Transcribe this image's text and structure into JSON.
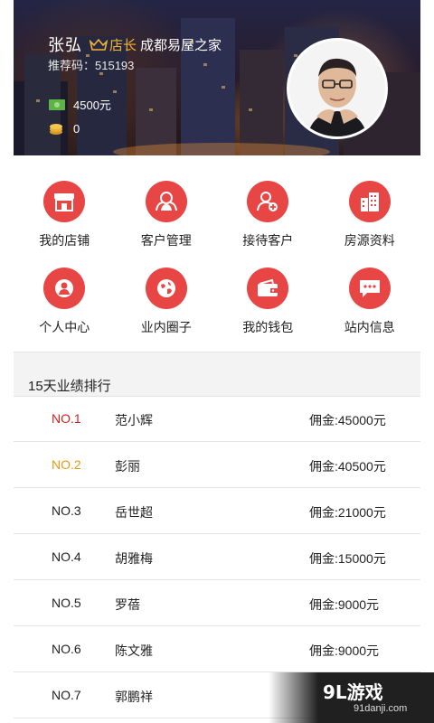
{
  "header": {
    "name": "张弘",
    "role": "店长",
    "store": "成都易屋之家",
    "referral_code": "推荐码：515193",
    "balance": "4500元",
    "coins": "0"
  },
  "menu": [
    {
      "label": "我的店铺",
      "icon": "shop-icon"
    },
    {
      "label": "客户管理",
      "icon": "users-icon"
    },
    {
      "label": "接待客户",
      "icon": "add-user-icon"
    },
    {
      "label": "房源资料",
      "icon": "building-icon"
    },
    {
      "label": "个人中心",
      "icon": "person-icon"
    },
    {
      "label": "业内圈子",
      "icon": "globe-icon"
    },
    {
      "label": "我的钱包",
      "icon": "wallet-icon"
    },
    {
      "label": "站内信息",
      "icon": "message-icon"
    }
  ],
  "ranking": {
    "title": "15天业绩排行",
    "rows": [
      {
        "no": "NO.1",
        "name": "范小辉",
        "amount": "佣金:45000元"
      },
      {
        "no": "NO.2",
        "name": "彭丽",
        "amount": "佣金:40500元"
      },
      {
        "no": "NO.3",
        "name": "岳世超",
        "amount": "佣金:21000元"
      },
      {
        "no": "NO.4",
        "name": "胡雅梅",
        "amount": "佣金:15000元"
      },
      {
        "no": "NO.5",
        "name": "罗蓓",
        "amount": "佣金:9000元"
      },
      {
        "no": "NO.6",
        "name": "陈文雅",
        "amount": "佣金:9000元"
      },
      {
        "no": "NO.7",
        "name": "郭鹏祥",
        "amount": ""
      }
    ]
  },
  "colors": {
    "accent": "#e84545",
    "rank1": "#d21f1f",
    "rank2": "#e39a14",
    "crown": "#f5b335"
  },
  "watermark": {
    "logo": "9L游戏",
    "site": "91danji.com"
  }
}
